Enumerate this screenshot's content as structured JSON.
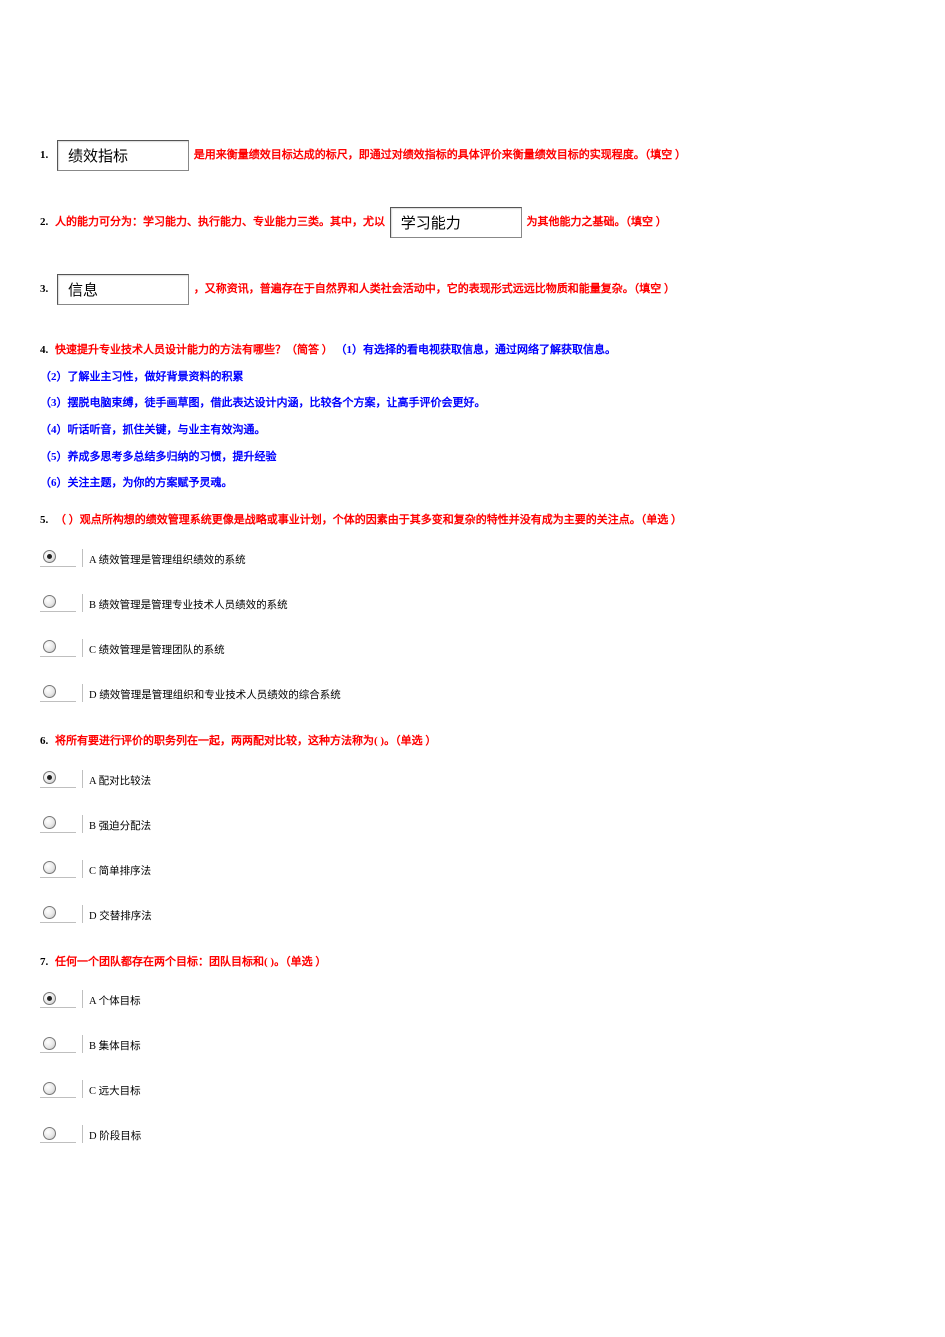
{
  "q1": {
    "num": "1.",
    "input": "绩效指标",
    "text": "是用来衡量绩效目标达成的标尺，即通过对绩效指标的具体评价来衡量绩效目标的实现程度。（填空 ）"
  },
  "q2": {
    "num": "2.",
    "pre": "人的能力可分为：学习能力、执行能力、专业能力三类。其中，尤以",
    "input": "学习能力",
    "post": "为其他能力之基础。（填空 ）"
  },
  "q3": {
    "num": "3.",
    "input": "信息",
    "text": "，又称资讯，普遍存在于自然界和人类社会活动中，它的表现形式远远比物质和能量复杂。（填空 ）"
  },
  "q4": {
    "num": "4.",
    "stem": "快速提升专业技术人员设计能力的方法有哪些？（简答 ）",
    "a1": "（1）有选择的看电视获取信息，通过网络了解获取信息。",
    "a2": "（2）了解业主习性，做好背景资料的积累",
    "a3": "（3）摆脱电脑束缚，徒手画草图，借此表达设计内涵，比较各个方案，让高手评价会更好。",
    "a4": "（4）听话听音，抓住关键，与业主有效沟通。",
    "a5": "（5）养成多思考多总结多归纳的习惯，提升经验",
    "a6": "（6）关注主题，为你的方案赋予灵魂。"
  },
  "q5": {
    "num": "5.",
    "stem": "（ ）观点所构想的绩效管理系统更像是战略或事业计划，个体的因素由于其多变和复杂的特性并没有成为主要的关注点。（单选 ）",
    "options": [
      {
        "label": "A 绩效管理是管理组织绩效的系统",
        "checked": true
      },
      {
        "label": "B 绩效管理是管理专业技术人员绩效的系统",
        "checked": false
      },
      {
        "label": "C 绩效管理是管理团队的系统",
        "checked": false
      },
      {
        "label": "D 绩效管理是管理组织和专业技术人员绩效的综合系统",
        "checked": false
      }
    ]
  },
  "q6": {
    "num": "6.",
    "stem": "将所有要进行评价的职务列在一起，两两配对比较，这种方法称为( )。（单选 ）",
    "options": [
      {
        "label": "A 配对比较法",
        "checked": true
      },
      {
        "label": "B 强迫分配法",
        "checked": false
      },
      {
        "label": "C 简单排序法",
        "checked": false
      },
      {
        "label": "D 交替排序法",
        "checked": false
      }
    ]
  },
  "q7": {
    "num": "7.",
    "stem": "任何一个团队都存在两个目标：团队目标和( )。（单选 ）",
    "options": [
      {
        "label": "A 个体目标",
        "checked": true
      },
      {
        "label": "B 集体目标",
        "checked": false
      },
      {
        "label": "C 远大目标",
        "checked": false
      },
      {
        "label": "D 阶段目标",
        "checked": false
      }
    ]
  }
}
